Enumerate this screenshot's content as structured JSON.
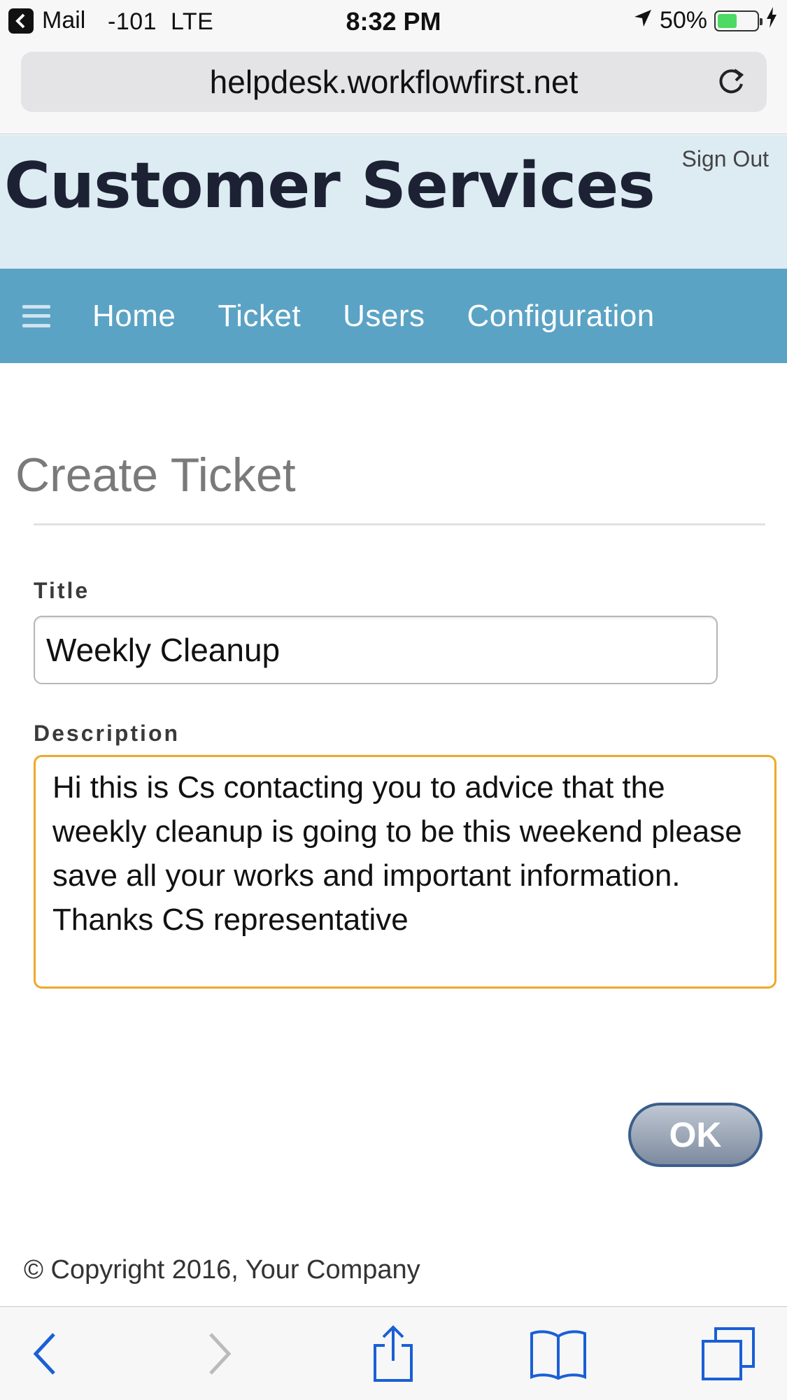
{
  "status_bar": {
    "back_app": "Mail",
    "carrier": "-101  LTE",
    "time": "8:32 PM",
    "battery": "50%",
    "battery_level": 0.5,
    "icons": [
      "back-chevron-icon",
      "location-arrow-icon",
      "battery-icon",
      "charging-bolt-icon"
    ]
  },
  "browser": {
    "url": "helpdesk.workflowfirst.net",
    "icons": [
      "reload-icon"
    ]
  },
  "header": {
    "title": "Customer Services",
    "sign_out": "Sign Out"
  },
  "nav": {
    "menu_icon": "hamburger-menu-icon",
    "items": [
      "Home",
      "Ticket",
      "Users",
      "Configuration"
    ]
  },
  "form": {
    "page_title": "Create Ticket",
    "title_label": "Title",
    "title_value": "Weekly Cleanup",
    "description_label": "Description",
    "description_value": "Hi this is Cs contacting you to advice that the weekly cleanup is going to be this weekend please save all your works and important information. Thanks CS representative",
    "ok_label": "OK"
  },
  "footer": {
    "copyright": "© Copyright 2016, Your Company"
  },
  "toolbar": {
    "icons": [
      "back-icon",
      "forward-icon",
      "share-icon",
      "bookmarks-icon",
      "tabs-icon"
    ]
  },
  "colors": {
    "header_bg": "#ddebf3",
    "nav_bg": "#5ba3c4",
    "focus_border": "#f0a82a",
    "toolbar_tint": "#1a5fd6"
  }
}
